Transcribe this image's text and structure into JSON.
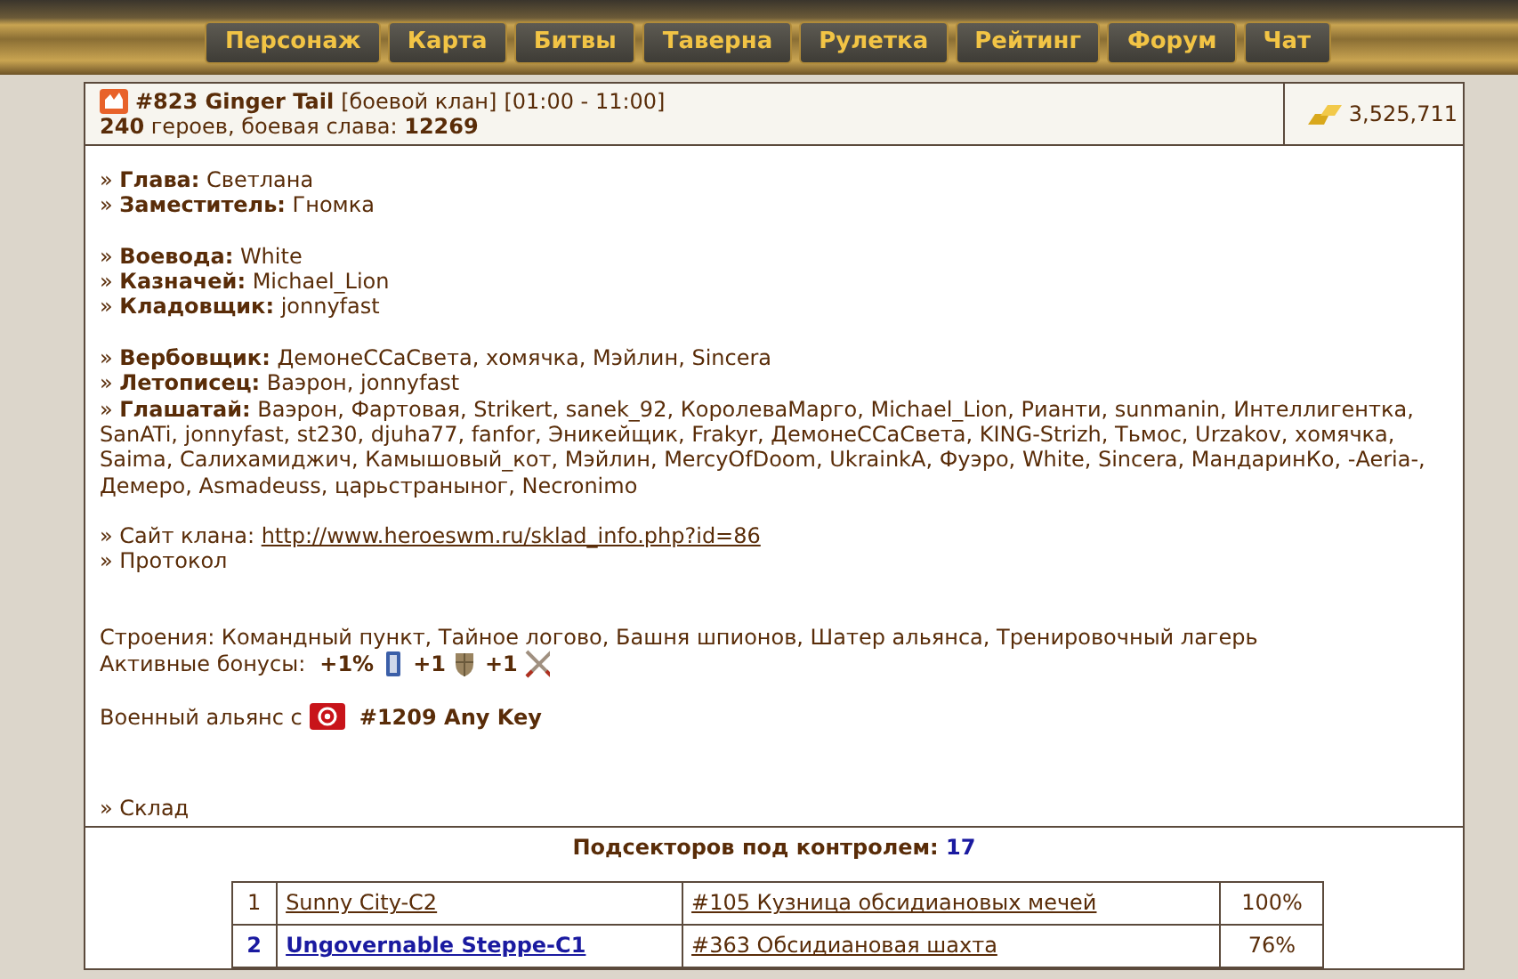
{
  "nav": [
    "Персонаж",
    "Карта",
    "Битвы",
    "Таверна",
    "Рулетка",
    "Рейтинг",
    "Форум",
    "Чат"
  ],
  "clan": {
    "number": "#823 Ginger Tail",
    "type": "[боевой клан]",
    "hours": "[01:00 - 11:00]",
    "heroes": "240",
    "heroes_label": "героев, боевая слава:",
    "glory": "12269",
    "treasury": "3,525,711"
  },
  "officer_groups": [
    [
      "» **Глава:** Светлана",
      "» **Заместитель:** Гномка"
    ],
    [
      "» **Воевода:** White",
      "» **Казначей:** Michael_Lion",
      "» **Кладовщик:** jonnyfast"
    ],
    [
      "» **Вербовщик:** ДемонеССаСвета, хомячка, Мэйлин, Sincera",
      "» **Летописец:** Ваэрон, jonnyfast",
      "» **Глашатай:** Ваэрон, Фартовая, Strikert, sanek_92, КоролеваМарго, Michael_Lion, Рианти, sunmanin, Интеллигентка, SanATi, jonnyfast, st230, djuha77, fanfor, Эникейщик, Frakyr, ДемонеССаСвета, KING-Strizh, Тьмос, Urzakov, хомячка, Saima, Салихамиджич, Камышовый_кот, Мэйлин, MercyOfDoom, UkrainkA, Фуэро, White, Sincera, МандаринКо, -Aeria-, Демеро, Asmadeuss, царьстраныног, Necronimo"
    ]
  ],
  "site": {
    "label": "» Сайт клана:",
    "url": "http://www.heroeswm.ru/sklad_info.php?id=86"
  },
  "protocol": "» Протокол",
  "buildings": "Строения: Командный пункт, Тайное логово, Башня шпионов, Шатер альянса, Тренировочный лагерь",
  "bonuses": {
    "label": "Активные бонусы:",
    "items": [
      {
        "value": "+1%",
        "kind": "scroll"
      },
      {
        "value": "+1",
        "kind": "shield"
      },
      {
        "value": "+1",
        "kind": "swords"
      }
    ]
  },
  "alliance": {
    "label": "Военный альянс с",
    "clan": "#1209 Any Key"
  },
  "storage": "» Склад",
  "subsectors": {
    "label": "Подсекторов под контролем:",
    "count": "17",
    "rows": [
      {
        "num": "1",
        "sector": "Sunny City-C2",
        "building": "#105 Кузница обсидиановых мечей",
        "percent": "100%",
        "highlighted": false
      },
      {
        "num": "2",
        "sector": "Ungovernable Steppe-C1",
        "building": "#363 Обсидиановая шахта",
        "percent": "76%",
        "highlighted": true
      }
    ]
  }
}
